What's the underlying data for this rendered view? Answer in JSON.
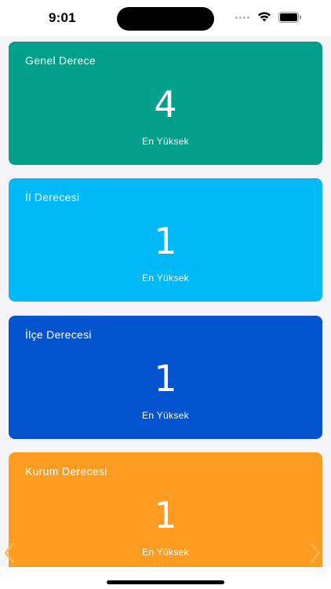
{
  "status_bar": {
    "time": "9:01"
  },
  "cards": [
    {
      "title": "Genel Derece",
      "value": "4",
      "subtitle": "En Yüksek",
      "color": "#02a08a"
    },
    {
      "title": "İl Derecesi",
      "value": "1",
      "subtitle": "En Yüksek",
      "color": "#00b9f6"
    },
    {
      "title": "İlçe Derecesi",
      "value": "1",
      "subtitle": "En Yüksek",
      "color": "#0453cf"
    },
    {
      "title": "Kurum Derecesi",
      "value": "1",
      "subtitle": "En Yüksek",
      "color": "#fe9c21"
    }
  ],
  "pager": {
    "left_icon": "chevron-left-icon",
    "right_icon": "chevron-right-icon",
    "arrow_color": "#fdb84a"
  }
}
